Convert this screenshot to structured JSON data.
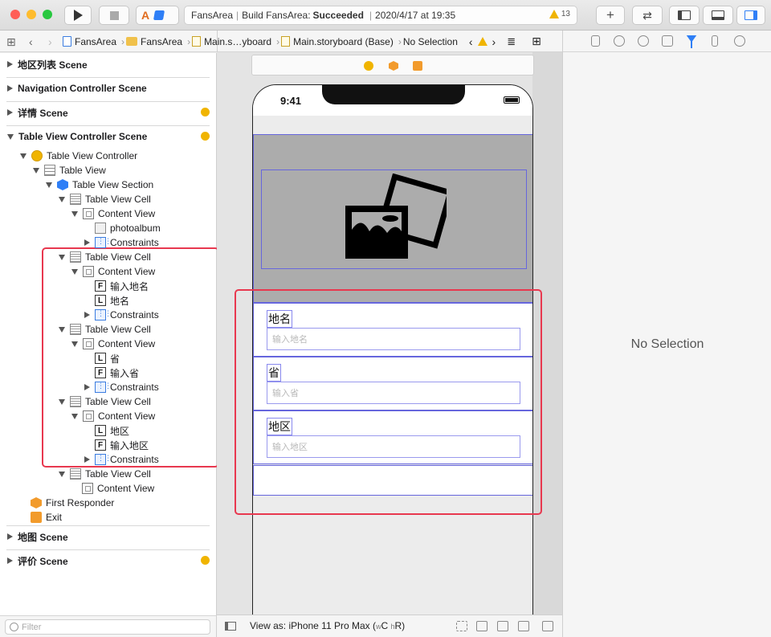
{
  "toolbar": {
    "scheme_target": "A",
    "activity": {
      "project": "FansArea",
      "action": "Build FansArea:",
      "status": "Succeeded",
      "timestamp": "2020/4/17 at 19:35",
      "warning_count": "13"
    },
    "add_label": "+",
    "colors": {
      "close": "#ff5f57",
      "minimize": "#febc2e",
      "zoom": "#28c840"
    }
  },
  "jump_bar": {
    "crumbs": [
      "FansArea",
      "FansArea",
      "Main.s…yboard",
      "Main.storyboard (Base)",
      "No Selection"
    ]
  },
  "outline": {
    "scenes": [
      {
        "label": "地区列表 Scene",
        "expanded": false,
        "badge": false
      },
      {
        "label": "Navigation Controller Scene",
        "expanded": false,
        "badge": false
      },
      {
        "label": "详情 Scene",
        "expanded": false,
        "badge": true
      },
      {
        "label": "Table View Controller Scene",
        "expanded": true,
        "badge": true
      },
      {
        "label": "地图 Scene",
        "expanded": false,
        "badge": false
      },
      {
        "label": "评价 Scene",
        "expanded": false,
        "badge": true
      }
    ],
    "tree": [
      {
        "label": "Table View Controller",
        "icon": "view-controller-icon"
      },
      {
        "label": "Table View",
        "icon": "table-view-icon"
      },
      {
        "label": "Table View Section",
        "icon": "section-icon"
      },
      {
        "label": "Table View Cell",
        "icon": "table-cell-icon"
      },
      {
        "label": "Content View",
        "icon": "content-view-icon"
      },
      {
        "label": "photoalbum",
        "icon": "image-view-icon"
      },
      {
        "label": "Constraints",
        "icon": "constraints-icon"
      },
      {
        "label": "Table View Cell",
        "icon": "table-cell-icon"
      },
      {
        "label": "Content View",
        "icon": "content-view-icon"
      },
      {
        "label": "输入地名",
        "icon": "text-field-icon",
        "glyph": "F"
      },
      {
        "label": "地名",
        "icon": "label-icon",
        "glyph": "L"
      },
      {
        "label": "Constraints",
        "icon": "constraints-icon"
      },
      {
        "label": "Table View Cell",
        "icon": "table-cell-icon"
      },
      {
        "label": "Content View",
        "icon": "content-view-icon"
      },
      {
        "label": "省",
        "icon": "label-icon",
        "glyph": "L"
      },
      {
        "label": "输入省",
        "icon": "text-field-icon",
        "glyph": "F"
      },
      {
        "label": "Constraints",
        "icon": "constraints-icon"
      },
      {
        "label": "Table View Cell",
        "icon": "table-cell-icon"
      },
      {
        "label": "Content View",
        "icon": "content-view-icon"
      },
      {
        "label": "地区",
        "icon": "label-icon",
        "glyph": "L"
      },
      {
        "label": "输入地区",
        "icon": "text-field-icon",
        "glyph": "F"
      },
      {
        "label": "Constraints",
        "icon": "constraints-icon"
      },
      {
        "label": "Table View Cell",
        "icon": "table-cell-icon"
      },
      {
        "label": "Content View",
        "icon": "content-view-icon"
      },
      {
        "label": "First Responder",
        "icon": "first-responder-icon"
      },
      {
        "label": "Exit",
        "icon": "exit-icon"
      }
    ],
    "filter_placeholder": "Filter"
  },
  "canvas": {
    "status_time": "9:41",
    "form": [
      {
        "label": "地名",
        "placeholder": "输入地名"
      },
      {
        "label": "省",
        "placeholder": "输入省"
      },
      {
        "label": "地区",
        "placeholder": "输入地区"
      }
    ],
    "view_as": {
      "prefix": "View as: iPhone 11 Pro Max (",
      "w": "w",
      "C": "C",
      "h": "h",
      "R": "R",
      "suffix": ")"
    }
  },
  "inspector": {
    "empty_text": "No Selection"
  },
  "highlight_color": "#e8384f",
  "accent_color": "#3a7ce0"
}
